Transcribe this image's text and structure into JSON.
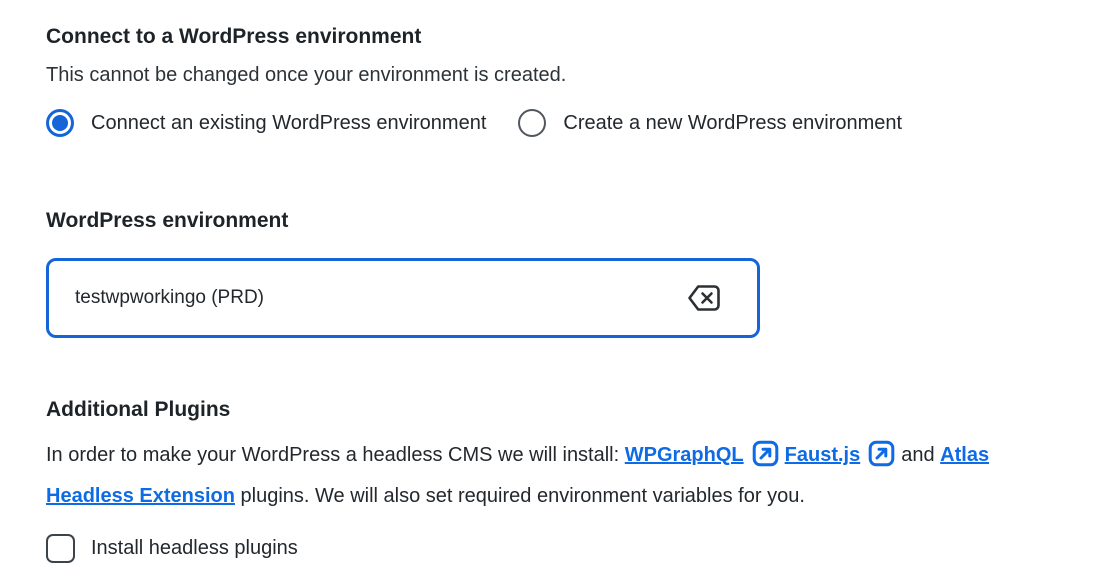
{
  "colors": {
    "accent": "#1565d9",
    "link": "#0d6be6",
    "text": "#23282d",
    "control_border": "#50575e"
  },
  "section_connect": {
    "heading": "Connect to a WordPress environment",
    "description": "This cannot be changed once your environment is created.",
    "radio_options": [
      {
        "label": "Connect an existing WordPress environment",
        "selected": true
      },
      {
        "label": "Create a new WordPress environment",
        "selected": false
      }
    ]
  },
  "environment_field": {
    "label": "WordPress environment",
    "value": "testwpworkingo (PRD)",
    "clear_icon": "backspace-icon"
  },
  "section_plugins": {
    "heading": "Additional Plugins",
    "description_prefix": "In order to make your WordPress a headless CMS we will install: ",
    "links": [
      {
        "label": "WPGraphQL",
        "external_icon": "external-link-icon"
      },
      {
        "label": "Faust.js",
        "external_icon": "external-link-icon"
      }
    ],
    "and_text": "and ",
    "atlas_link_label": "Atlas Headless Extension",
    "description_suffix": " plugins. We will also set required environment variables for you.",
    "checkbox": {
      "label": "Install headless plugins",
      "checked": false
    }
  }
}
